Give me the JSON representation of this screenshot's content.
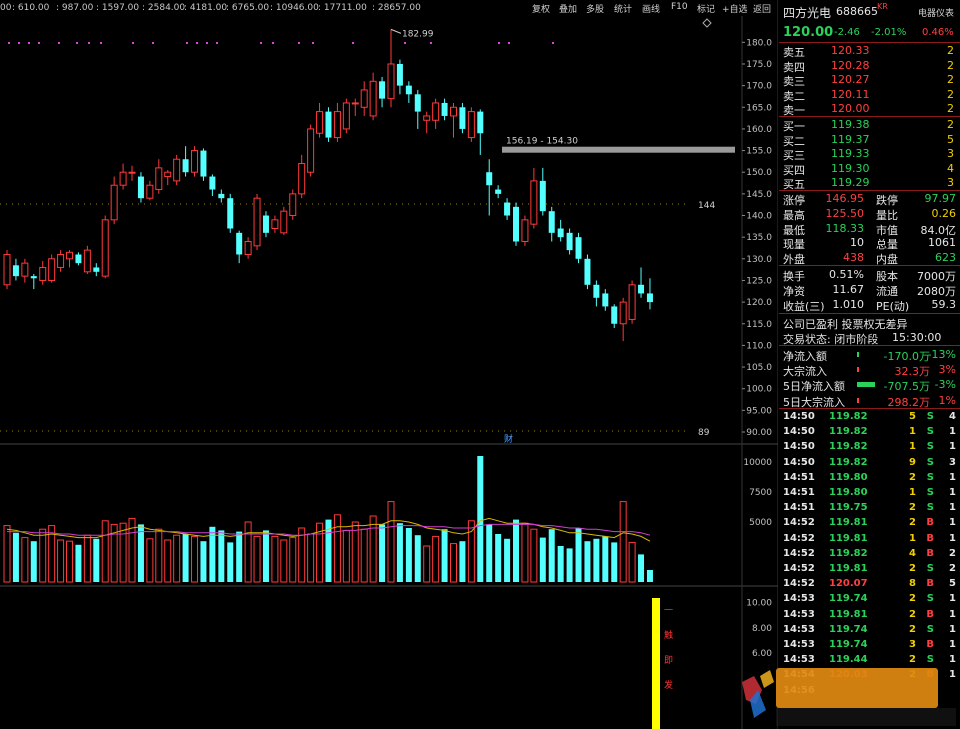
{
  "topbar": {
    "fib_levels": [
      "00",
      "610.00",
      "987.00",
      "1597.00",
      "2584.00",
      "4181.00",
      "6765.00",
      "10946.00",
      "17711.00",
      "28657.00"
    ],
    "buttons": [
      "复权",
      "叠加",
      "多股",
      "统计",
      "画线",
      "F10",
      "标记",
      "+自选",
      "返回"
    ]
  },
  "stock": {
    "name": "四方光电",
    "code": "688665",
    "market_tag": "KR",
    "tool_label": "电器仪表",
    "price": "120.00",
    "change": "-2.46",
    "change_pct": "-2.01%",
    "turnover_tag": "0.46%"
  },
  "order_book": {
    "asks": [
      {
        "label": "卖五",
        "price": "120.33",
        "vol": "2"
      },
      {
        "label": "卖四",
        "price": "120.28",
        "vol": "2"
      },
      {
        "label": "卖三",
        "price": "120.27",
        "vol": "2"
      },
      {
        "label": "卖二",
        "price": "120.11",
        "vol": "2"
      },
      {
        "label": "卖一",
        "price": "120.00",
        "vol": "2"
      }
    ],
    "bids": [
      {
        "label": "买一",
        "price": "119.38",
        "vol": "2"
      },
      {
        "label": "买二",
        "price": "119.37",
        "vol": "5"
      },
      {
        "label": "买三",
        "price": "119.33",
        "vol": "3"
      },
      {
        "label": "买四",
        "price": "119.30",
        "vol": "4"
      },
      {
        "label": "买五",
        "price": "119.29",
        "vol": "3"
      }
    ]
  },
  "quote": [
    {
      "l1": "涨停",
      "v1": "146.95",
      "c1": "red",
      "l2": "跌停",
      "v2": "97.97",
      "c2": "green"
    },
    {
      "l1": "最高",
      "v1": "125.50",
      "c1": "red",
      "l2": "量比",
      "v2": "0.26",
      "c2": "yellow"
    },
    {
      "l1": "最低",
      "v1": "118.33",
      "c1": "green",
      "l2": "市值",
      "v2": "84.0亿",
      "c2": "white"
    },
    {
      "l1": "现量",
      "v1": "10",
      "c1": "white",
      "l2": "总量",
      "v2": "1061",
      "c2": "white"
    },
    {
      "l1": "外盘",
      "v1": "438",
      "c1": "red",
      "l2": "内盘",
      "v2": "623",
      "c2": "green"
    }
  ],
  "quote2": [
    {
      "l1": "换手",
      "v1": "0.51%",
      "c1": "white",
      "l2": "股本",
      "v2": "7000万",
      "c2": "white"
    },
    {
      "l1": "净资",
      "v1": "11.67",
      "c1": "white",
      "l2": "流通",
      "v2": "2080万",
      "c2": "white"
    },
    {
      "l1": "收益(三)",
      "v1": "1.010",
      "c1": "white",
      "l2": "PE(动)",
      "v2": "59.3",
      "c2": "white"
    }
  ],
  "info": {
    "line1": "公司已盈利 投票权无差异",
    "line2_label": "交易状态: 闭市阶段",
    "line2_time": "15:30:00"
  },
  "flows": [
    {
      "label": "净流入额",
      "val": "-170.0万",
      "pct": "-13%",
      "color": "green",
      "bar": 0.05
    },
    {
      "label": "大宗流入",
      "val": "32.3万",
      "pct": "3%",
      "color": "red",
      "bar": 0.02
    },
    {
      "label": "5日净流入额",
      "val": "-707.5万",
      "pct": "-3%",
      "color": "green",
      "bar": 0.9
    },
    {
      "label": "5日大宗流入",
      "val": "298.2万",
      "pct": "1%",
      "color": "red",
      "bar": 0.03
    }
  ],
  "trades": [
    {
      "t": "14:50",
      "p": "119.82",
      "v": "5",
      "bs": "S",
      "n": "4"
    },
    {
      "t": "14:50",
      "p": "119.82",
      "v": "1",
      "bs": "S",
      "n": "1"
    },
    {
      "t": "14:50",
      "p": "119.82",
      "v": "1",
      "bs": "S",
      "n": "1"
    },
    {
      "t": "14:50",
      "p": "119.82",
      "v": "9",
      "bs": "S",
      "n": "3"
    },
    {
      "t": "14:51",
      "p": "119.80",
      "v": "2",
      "bs": "S",
      "n": "1"
    },
    {
      "t": "14:51",
      "p": "119.80",
      "v": "1",
      "bs": "S",
      "n": "1"
    },
    {
      "t": "14:51",
      "p": "119.75",
      "v": "2",
      "bs": "S",
      "n": "1"
    },
    {
      "t": "14:52",
      "p": "119.81",
      "v": "2",
      "bs": "B",
      "n": "1"
    },
    {
      "t": "14:52",
      "p": "119.81",
      "v": "1",
      "bs": "B",
      "n": "1"
    },
    {
      "t": "14:52",
      "p": "119.82",
      "v": "4",
      "bs": "B",
      "n": "2"
    },
    {
      "t": "14:52",
      "p": "119.81",
      "v": "2",
      "bs": "S",
      "n": "2"
    },
    {
      "t": "14:52",
      "p": "120.07",
      "v": "8",
      "bs": "B",
      "n": "5"
    },
    {
      "t": "14:53",
      "p": "119.74",
      "v": "2",
      "bs": "S",
      "n": "1"
    },
    {
      "t": "14:53",
      "p": "119.81",
      "v": "2",
      "bs": "B",
      "n": "1"
    },
    {
      "t": "14:53",
      "p": "119.74",
      "v": "2",
      "bs": "S",
      "n": "1"
    },
    {
      "t": "14:53",
      "p": "119.74",
      "v": "3",
      "bs": "B",
      "n": "1"
    },
    {
      "t": "14:53",
      "p": "119.44",
      "v": "2",
      "bs": "S",
      "n": "1"
    },
    {
      "t": "14:54",
      "p": "120.03",
      "v": "2",
      "bs": "B",
      "n": "1"
    },
    {
      "t": "14:56",
      "p": "",
      "v": "",
      "bs": "",
      "n": ""
    }
  ],
  "colors": {
    "up": "#ff3a3a",
    "down": "#54ffff",
    "ma1": "#d8b800",
    "ma2": "#d040d0",
    "level_line": "#9a9a9a",
    "signal_bar": "#ffff00"
  },
  "chart_data": {
    "type": "candlestick",
    "price_axis_ticks": [
      "180.0",
      "175.0",
      "170.0",
      "165.0",
      "160.0",
      "155.0",
      "150.0",
      "145.0",
      "140.0",
      "135.0",
      "130.0",
      "125.0",
      "120.0",
      "115.0",
      "110.0",
      "105.0",
      "100.0",
      "95.00",
      "90.00"
    ],
    "ylim": [
      90,
      182
    ],
    "volume_axis_ticks": [
      "10000",
      "7500",
      "5000"
    ],
    "volume_ylim": [
      0,
      11000
    ],
    "indicator_axis_ticks": [
      "10.00",
      "8.00",
      "6.00"
    ],
    "annotations": {
      "high_label": "182.99",
      "level_label": "156.19 - 154.30",
      "level_value": 155.2,
      "right_level_top": "144",
      "right_level_bottom": "89",
      "fin_marker": "财",
      "signal_text": [
        "一",
        "触",
        "即",
        "发"
      ]
    },
    "candles": [
      {
        "o": 124.0,
        "c": 131.0,
        "h": 132.0,
        "l": 123.0
      },
      {
        "o": 128.5,
        "c": 126.0,
        "h": 130.0,
        "l": 125.0
      },
      {
        "o": 126.0,
        "c": 129.0,
        "h": 130.0,
        "l": 124.5
      },
      {
        "o": 126.0,
        "c": 125.5,
        "h": 126.5,
        "l": 123.0
      },
      {
        "o": 125.0,
        "c": 128.0,
        "h": 129.5,
        "l": 124.0
      },
      {
        "o": 125.0,
        "c": 130.0,
        "h": 131.0,
        "l": 124.5
      },
      {
        "o": 128.0,
        "c": 131.0,
        "h": 132.0,
        "l": 127.0
      },
      {
        "o": 130.0,
        "c": 131.5,
        "h": 132.0,
        "l": 128.0
      },
      {
        "o": 131.0,
        "c": 129.0,
        "h": 131.5,
        "l": 128.5
      },
      {
        "o": 127.0,
        "c": 132.0,
        "h": 133.0,
        "l": 126.5
      },
      {
        "o": 128.0,
        "c": 127.0,
        "h": 129.0,
        "l": 126.0
      },
      {
        "o": 126.0,
        "c": 139.0,
        "h": 140.0,
        "l": 125.5
      },
      {
        "o": 139.0,
        "c": 147.0,
        "h": 149.0,
        "l": 138.0
      },
      {
        "o": 147.0,
        "c": 150.0,
        "h": 152.0,
        "l": 146.0
      },
      {
        "o": 150.0,
        "c": 150.0,
        "h": 151.5,
        "l": 148.0
      },
      {
        "o": 149.0,
        "c": 144.0,
        "h": 150.0,
        "l": 143.0
      },
      {
        "o": 144.0,
        "c": 147.0,
        "h": 148.0,
        "l": 143.5
      },
      {
        "o": 146.0,
        "c": 151.0,
        "h": 153.0,
        "l": 145.0
      },
      {
        "o": 149.0,
        "c": 150.0,
        "h": 150.5,
        "l": 147.0
      },
      {
        "o": 148.0,
        "c": 153.0,
        "h": 154.0,
        "l": 147.0
      },
      {
        "o": 153.0,
        "c": 150.0,
        "h": 156.0,
        "l": 149.0
      },
      {
        "o": 150.0,
        "c": 155.0,
        "h": 156.0,
        "l": 149.0
      },
      {
        "o": 155.0,
        "c": 149.0,
        "h": 155.5,
        "l": 148.0
      },
      {
        "o": 149.0,
        "c": 146.0,
        "h": 149.5,
        "l": 144.5
      },
      {
        "o": 145.0,
        "c": 144.0,
        "h": 146.0,
        "l": 143.0
      },
      {
        "o": 144.0,
        "c": 137.0,
        "h": 145.0,
        "l": 136.0
      },
      {
        "o": 136.0,
        "c": 131.0,
        "h": 136.5,
        "l": 129.0
      },
      {
        "o": 131.0,
        "c": 134.0,
        "h": 135.0,
        "l": 130.0
      },
      {
        "o": 133.0,
        "c": 144.0,
        "h": 145.0,
        "l": 132.0
      },
      {
        "o": 140.0,
        "c": 136.0,
        "h": 141.0,
        "l": 135.0
      },
      {
        "o": 137.0,
        "c": 139.0,
        "h": 140.0,
        "l": 136.0
      },
      {
        "o": 136.0,
        "c": 141.0,
        "h": 142.0,
        "l": 135.5
      },
      {
        "o": 140.0,
        "c": 145.0,
        "h": 146.0,
        "l": 139.0
      },
      {
        "o": 145.0,
        "c": 152.0,
        "h": 154.0,
        "l": 144.0
      },
      {
        "o": 150.0,
        "c": 160.0,
        "h": 161.0,
        "l": 149.0
      },
      {
        "o": 159.0,
        "c": 164.0,
        "h": 166.0,
        "l": 158.0
      },
      {
        "o": 164.0,
        "c": 158.0,
        "h": 165.0,
        "l": 157.0
      },
      {
        "o": 158.0,
        "c": 164.0,
        "h": 166.0,
        "l": 157.0
      },
      {
        "o": 160.0,
        "c": 166.0,
        "h": 167.0,
        "l": 159.0
      },
      {
        "o": 166.0,
        "c": 166.0,
        "h": 167.0,
        "l": 163.0
      },
      {
        "o": 165.0,
        "c": 169.0,
        "h": 171.0,
        "l": 163.0
      },
      {
        "o": 163.0,
        "c": 171.0,
        "h": 173.0,
        "l": 162.0
      },
      {
        "o": 171.0,
        "c": 167.0,
        "h": 172.0,
        "l": 165.0
      },
      {
        "o": 167.0,
        "c": 175.0,
        "h": 182.99,
        "l": 165.0
      },
      {
        "o": 175.0,
        "c": 170.0,
        "h": 176.0,
        "l": 168.0
      },
      {
        "o": 170.0,
        "c": 168.0,
        "h": 171.0,
        "l": 166.0
      },
      {
        "o": 168.0,
        "c": 164.0,
        "h": 169.0,
        "l": 160.0
      },
      {
        "o": 162.0,
        "c": 163.0,
        "h": 164.0,
        "l": 159.0
      },
      {
        "o": 162.0,
        "c": 166.0,
        "h": 167.0,
        "l": 160.0
      },
      {
        "o": 166.0,
        "c": 163.0,
        "h": 167.0,
        "l": 162.0
      },
      {
        "o": 163.0,
        "c": 165.0,
        "h": 166.0,
        "l": 158.0
      },
      {
        "o": 165.0,
        "c": 160.0,
        "h": 166.0,
        "l": 159.0
      },
      {
        "o": 158.0,
        "c": 164.0,
        "h": 165.0,
        "l": 157.0
      },
      {
        "o": 164.0,
        "c": 159.0,
        "h": 164.5,
        "l": 154.0
      },
      {
        "o": 150.0,
        "c": 147.0,
        "h": 153.0,
        "l": 140.0
      },
      {
        "o": 146.0,
        "c": 145.0,
        "h": 147.0,
        "l": 144.0
      },
      {
        "o": 143.0,
        "c": 140.0,
        "h": 144.0,
        "l": 139.0
      },
      {
        "o": 142.0,
        "c": 134.0,
        "h": 143.0,
        "l": 133.0
      },
      {
        "o": 134.0,
        "c": 139.0,
        "h": 140.0,
        "l": 133.0
      },
      {
        "o": 138.0,
        "c": 148.0,
        "h": 151.0,
        "l": 137.0
      },
      {
        "o": 148.0,
        "c": 141.0,
        "h": 151.0,
        "l": 140.0
      },
      {
        "o": 141.0,
        "c": 136.0,
        "h": 142.0,
        "l": 134.0
      },
      {
        "o": 137.0,
        "c": 135.0,
        "h": 139.0,
        "l": 134.0
      },
      {
        "o": 136.0,
        "c": 132.0,
        "h": 137.0,
        "l": 131.0
      },
      {
        "o": 135.0,
        "c": 130.0,
        "h": 136.0,
        "l": 129.0
      },
      {
        "o": 130.0,
        "c": 124.0,
        "h": 131.0,
        "l": 123.0
      },
      {
        "o": 124.0,
        "c": 121.0,
        "h": 125.0,
        "l": 119.0
      },
      {
        "o": 122.0,
        "c": 119.0,
        "h": 123.0,
        "l": 118.0
      },
      {
        "o": 119.0,
        "c": 115.0,
        "h": 119.5,
        "l": 114.0
      },
      {
        "o": 115.0,
        "c": 120.0,
        "h": 121.0,
        "l": 111.0
      },
      {
        "o": 116.0,
        "c": 124.0,
        "h": 125.0,
        "l": 115.0
      },
      {
        "o": 124.0,
        "c": 122.0,
        "h": 128.0,
        "l": 121.0
      },
      {
        "o": 122.0,
        "c": 120.0,
        "h": 125.5,
        "l": 118.33
      }
    ],
    "volumes": [
      4700,
      4100,
      3700,
      3400,
      4400,
      4700,
      3500,
      3400,
      3100,
      3900,
      3600,
      5100,
      4800,
      4900,
      5300,
      4800,
      3600,
      4400,
      3500,
      3900,
      4000,
      3800,
      3400,
      4600,
      4300,
      3300,
      4200,
      5000,
      3800,
      4300,
      3800,
      3500,
      3700,
      4500,
      4000,
      4900,
      5200,
      5600,
      4300,
      5000,
      4400,
      5500,
      4800,
      6700,
      4900,
      4500,
      3900,
      3000,
      3800,
      4400,
      3200,
      3400,
      5100,
      10500,
      4800,
      4000,
      3600,
      5200,
      4900,
      4400,
      3700,
      4400,
      3000,
      2800,
      4500,
      3400,
      3600,
      3800,
      3300,
      6700,
      3300,
      2300,
      1000
    ],
    "ma_vol_1": [
      4400,
      4300,
      4100,
      3900,
      3900,
      4000,
      3900,
      3800,
      3700,
      3700,
      3700,
      3900,
      4100,
      4300,
      4500,
      4600,
      4400,
      4300,
      4200,
      4100,
      4000,
      3900,
      3800,
      3900,
      3900,
      3800,
      3900,
      4100,
      4100,
      4100,
      4000,
      3900,
      3800,
      3900,
      4000,
      4200,
      4400,
      4600,
      4600,
      4700,
      4700,
      4800,
      4800,
      5100,
      5100,
      5000,
      4800,
      4500,
      4400,
      4300,
      4100,
      4000,
      4200,
      5100,
      5300,
      5100,
      4900,
      4900,
      4900,
      4800,
      4600,
      4500,
      4300,
      4100,
      4100,
      4000,
      3900,
      3800,
      3700,
      4100,
      4000,
      3800,
      3400
    ],
    "ma_vol_2": [
      4200,
      4200,
      4200,
      4100,
      4100,
      4100,
      4000,
      4000,
      3900,
      3900,
      3900,
      3900,
      4000,
      4000,
      4100,
      4200,
      4200,
      4200,
      4200,
      4200,
      4100,
      4100,
      4100,
      4100,
      4100,
      4000,
      4000,
      4000,
      4000,
      4000,
      4000,
      4000,
      3900,
      3900,
      4000,
      4000,
      4100,
      4200,
      4300,
      4300,
      4400,
      4500,
      4500,
      4600,
      4700,
      4700,
      4700,
      4600,
      4600,
      4600,
      4500,
      4500,
      4500,
      4700,
      4800,
      4800,
      4800,
      4800,
      4800,
      4800,
      4700,
      4700,
      4600,
      4500,
      4500,
      4400,
      4400,
      4300,
      4200,
      4200,
      4200,
      4100,
      3900
    ]
  }
}
